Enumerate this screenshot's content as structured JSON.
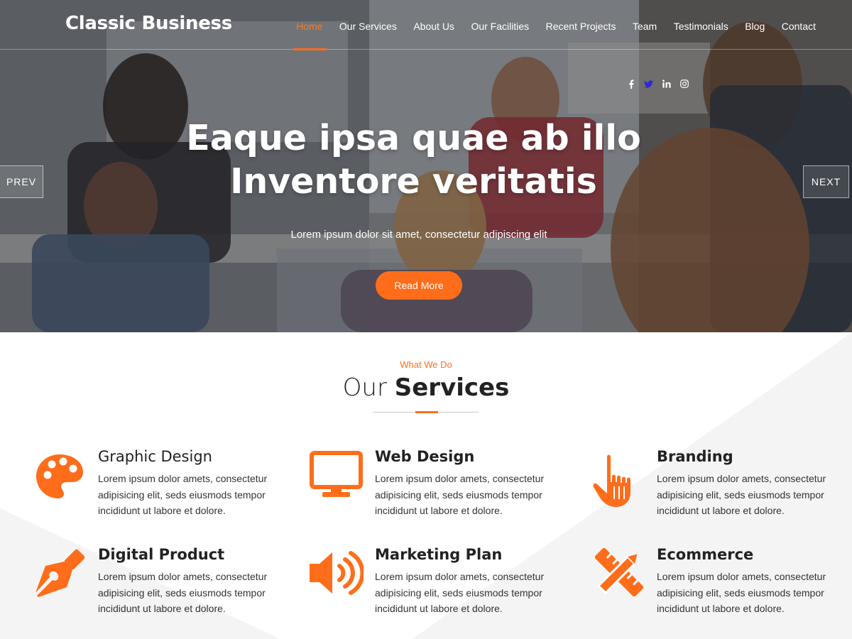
{
  "brand": "Classic Business",
  "nav": {
    "items": [
      {
        "label": "Home",
        "active": true
      },
      {
        "label": "Our Services"
      },
      {
        "label": "About Us"
      },
      {
        "label": "Our Facilities"
      },
      {
        "label": "Recent Projects"
      },
      {
        "label": "Team"
      },
      {
        "label": "Testimonials"
      },
      {
        "label": "Blog"
      },
      {
        "label": "Contact"
      }
    ]
  },
  "socials": [
    "facebook-icon",
    "twitter-icon",
    "linkedin-icon",
    "instagram-icon"
  ],
  "hero": {
    "title_line1": "Eaque ipsa quae ab illo",
    "title_line2": "Inventore veritatis",
    "subtitle": "Lorem ipsum dolor sit amet, consectetur adipiscing elit",
    "cta": "Read More",
    "prev": "PREV",
    "next": "NEXT"
  },
  "services": {
    "eyebrow": "What We Do",
    "title_light": "Our",
    "title_bold": "Services",
    "items": [
      {
        "title": "Graphic Design",
        "icon": "palette-icon",
        "desc": "Lorem ipsum dolor amets, consectetur adipisicing elit, seds eiusmods tempor incididunt ut labore et dolore."
      },
      {
        "title": "Web Design",
        "icon": "monitor-icon",
        "desc": "Lorem ipsum dolor amets, consectetur adipisicing elit, seds eiusmods tempor incididunt ut labore et dolore."
      },
      {
        "title": "Branding",
        "icon": "pointer-hand-icon",
        "desc": "Lorem ipsum dolor amets, consectetur adipisicing elit, seds eiusmods tempor incididunt ut labore et dolore."
      },
      {
        "title": "Digital Product",
        "icon": "pen-nib-icon",
        "desc": "Lorem ipsum dolor amets, consectetur adipisicing elit, seds eiusmods tempor incididunt ut labore et dolore."
      },
      {
        "title": "Marketing Plan",
        "icon": "speaker-icon",
        "desc": "Lorem ipsum dolor amets, consectetur adipisicing elit, seds eiusmods tempor incididunt ut labore et dolore."
      },
      {
        "title": "Ecommerce",
        "icon": "pencil-ruler-icon",
        "desc": "Lorem ipsum dolor amets, consectetur adipisicing elit, seds eiusmods tempor incididunt ut labore et dolore."
      }
    ]
  },
  "colors": {
    "accent": "#ff6d1a",
    "text_dark": "#222222",
    "light_bg": "#f4f4f4"
  }
}
